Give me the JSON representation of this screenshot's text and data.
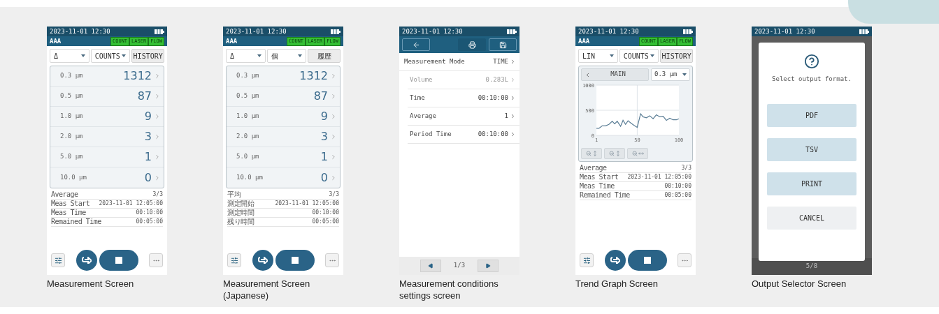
{
  "screens": [
    {
      "kind": "measurement",
      "caption": "Measurement Screen",
      "status_time": "2023-11-01 12:30",
      "title": "AAA",
      "indicators": [
        "COUNT",
        "LASER",
        "FLOW"
      ],
      "controls": [
        {
          "kind": "dropdown",
          "label": "Δ"
        },
        {
          "kind": "dropdown",
          "label": "COUNTS"
        },
        {
          "kind": "button",
          "label": "HISTORY"
        }
      ],
      "rows": [
        {
          "size": "0.3 µm",
          "count": "1312"
        },
        {
          "size": "0.5 µm",
          "count": "87"
        },
        {
          "size": "1.0 µm",
          "count": "9"
        },
        {
          "size": "2.0 µm",
          "count": "3"
        },
        {
          "size": "5.0 µm",
          "count": "1"
        },
        {
          "size": "10.0 µm",
          "count": "0"
        }
      ],
      "info": [
        {
          "label": "Average",
          "value": "3/3"
        },
        {
          "label": "Meas Start",
          "value": "2023-11-01 12:05:00"
        },
        {
          "label": "Meas Time",
          "value": "00:10:00"
        },
        {
          "label": "Remained Time",
          "value": "00:05:00"
        }
      ]
    },
    {
      "kind": "measurement",
      "caption": "Measurement Screen (Japanese)",
      "status_time": "2023-11-01 12:30",
      "title": "AAA",
      "indicators": [
        "COUNT",
        "LASER",
        "FLOW"
      ],
      "controls": [
        {
          "kind": "dropdown",
          "label": "Δ"
        },
        {
          "kind": "dropdown",
          "label": "個"
        },
        {
          "kind": "button",
          "label": "履歴"
        }
      ],
      "rows": [
        {
          "size": "0.3 µm",
          "count": "1312"
        },
        {
          "size": "0.5 µm",
          "count": "87"
        },
        {
          "size": "1.0 µm",
          "count": "9"
        },
        {
          "size": "2.0 µm",
          "count": "3"
        },
        {
          "size": "5.0 µm",
          "count": "1"
        },
        {
          "size": "10.0 µm",
          "count": "0"
        }
      ],
      "info": [
        {
          "label": "平均",
          "value": "3/3"
        },
        {
          "label": "測定開始",
          "value": "2023-11-01 12:05:00"
        },
        {
          "label": "測定時間",
          "value": "00:10:00"
        },
        {
          "label": "残り時間",
          "value": "00:05:00"
        }
      ]
    },
    {
      "kind": "settings",
      "caption": "Measurement conditions settings screen",
      "status_time": "2023-11-01 12:30",
      "settings": [
        {
          "label": "Measurement Mode",
          "value": "TIME",
          "disabled": false,
          "children": [
            {
              "label": "Volume",
              "value": "0.283L",
              "disabled": true
            },
            {
              "label": "Time",
              "value": "00:10:00",
              "disabled": false
            },
            {
              "label": "Average",
              "value": "1",
              "disabled": false
            },
            {
              "label": "Period Time",
              "value": "00:10:00",
              "disabled": false
            }
          ]
        }
      ],
      "pager": "1/3"
    },
    {
      "kind": "trend",
      "caption": "Trend Graph Screen",
      "status_time": "2023-11-01 12:30",
      "title": "AAA",
      "indicators": [
        "COUNT",
        "LASER",
        "FLOW"
      ],
      "controls": [
        {
          "kind": "dropdown",
          "label": "LIN"
        },
        {
          "kind": "dropdown",
          "label": "COUNTS"
        },
        {
          "kind": "button",
          "label": "HISTORY"
        }
      ],
      "graph_tab": "MAIN",
      "graph_size": "0.3 µm",
      "chart_data": {
        "type": "line",
        "x": [
          1,
          4,
          8,
          12,
          16,
          20,
          23,
          26,
          30,
          33,
          36,
          39,
          42,
          46,
          50,
          54,
          57,
          61,
          65,
          69,
          73,
          77,
          81,
          85,
          89,
          93,
          97,
          100
        ],
        "series": [
          {
            "color": "#5a7d95",
            "values": [
              140,
              140,
              190,
              190,
              220,
              280,
              230,
              280,
              180,
              300,
              220,
              290,
              250,
              200,
              160,
              430,
              370,
              350,
              390,
              330,
              410,
              370,
              380,
              300,
              340,
              310,
              310,
              330
            ]
          }
        ],
        "xlim": [
          1,
          100
        ],
        "ylim": [
          0,
          1000
        ],
        "xticks": [
          1,
          50,
          100
        ],
        "yticks": [
          0,
          500,
          1000
        ]
      },
      "info": [
        {
          "label": "Average",
          "value": "3/3"
        },
        {
          "label": "Meas Start",
          "value": "2023-11-01 12:05:00"
        },
        {
          "label": "Meas Time",
          "value": "00:10:00"
        },
        {
          "label": "Remained Time",
          "value": "00:05:00"
        }
      ]
    },
    {
      "kind": "dialog",
      "caption": "Output Selector Screen",
      "status_time": "2023-11-01 12:30",
      "message": "Select output format.",
      "buttons": [
        {
          "label": "PDF",
          "kind": "option"
        },
        {
          "label": "TSV",
          "kind": "option"
        },
        {
          "label": "PRINT",
          "kind": "option"
        },
        {
          "label": "CANCEL",
          "kind": "cancel"
        }
      ],
      "pager": "5/8"
    }
  ]
}
